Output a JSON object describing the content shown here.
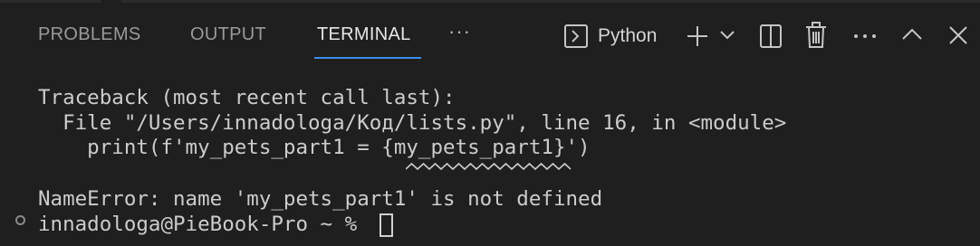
{
  "tabs": {
    "problems": "PROBLEMS",
    "output": "OUTPUT",
    "terminal": "TERMINAL",
    "more": "···"
  },
  "toolbar": {
    "terminal_type": "Python",
    "icons": [
      "terminal-icon",
      "add-icon",
      "chevron-down-icon",
      "split-icon",
      "trash-icon",
      "more-icon",
      "chevron-up-icon",
      "close-icon"
    ]
  },
  "terminal": {
    "lines": [
      "Traceback (most recent call last):",
      "  File \"/Users/innadologa/Код/lists.py\", line 16, in <module>",
      "    print(f'my_pets_part1 = {my_pets_part1}')",
      "NameError: name 'my_pets_part1' is not defined",
      "innadologa@PieBook-Pro ~ % "
    ]
  },
  "colors": {
    "background": "#1f1f1f",
    "accent": "#3b8eea",
    "text": "#cccccc"
  }
}
